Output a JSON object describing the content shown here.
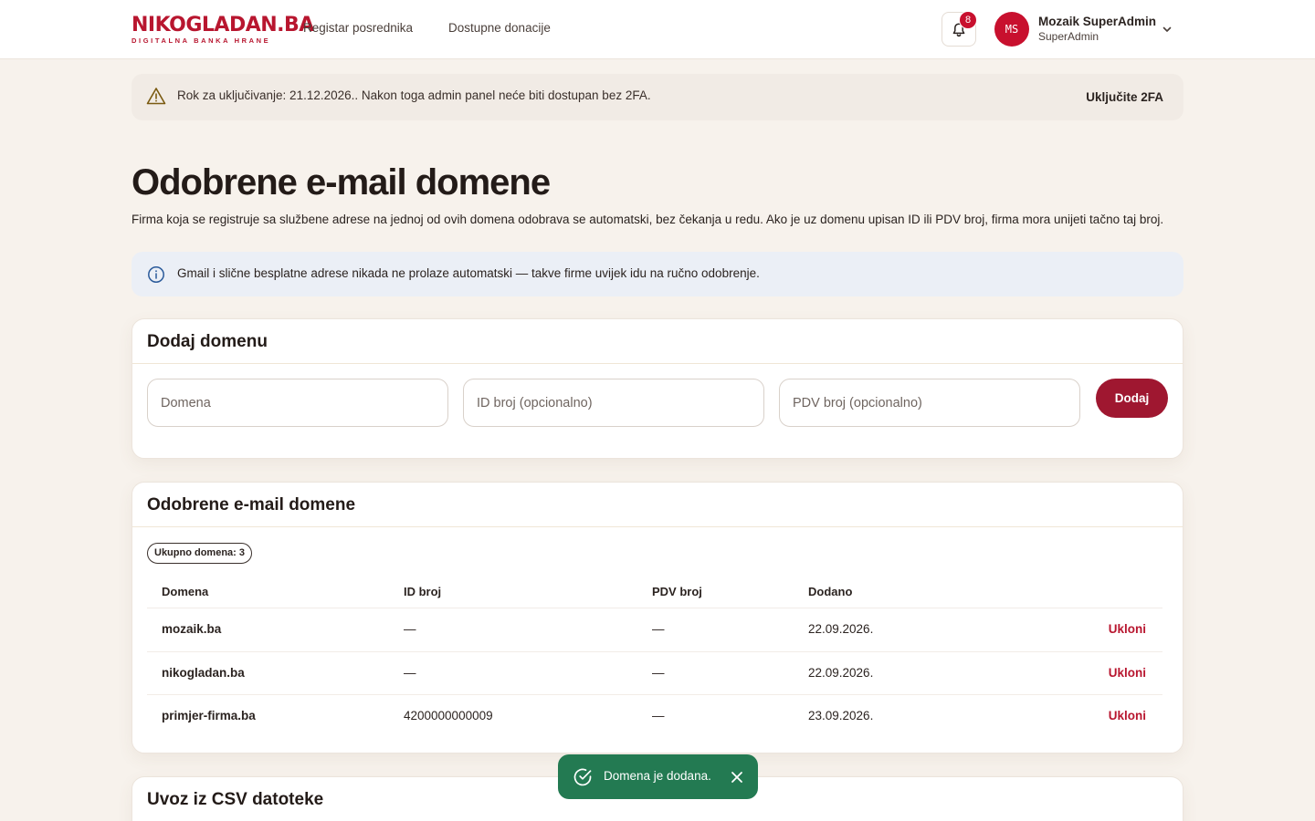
{
  "header": {
    "logo_part1": "NIKO",
    "logo_part2": "GLADAN.BA",
    "logo_sub": "DIGITALNA BANKA HRANE",
    "nav": [
      "Registar posrednika",
      "Dostupne donacije"
    ],
    "notifications_count": "8",
    "user_initials": "MS",
    "user_name": "Mozaik SuperAdmin",
    "user_role": "SuperAdmin"
  },
  "warning": {
    "text": "Rok za uključivanje: 21.12.2026.. Nakon toga admin panel neće biti dostupan bez 2FA.",
    "action": "Uključite 2FA"
  },
  "page": {
    "title": "Odobrene e-mail domene",
    "subtitle": "Firma koja se registruje sa službene adrese na jednoj od ovih domena odobrava se automatski, bez čekanja u redu. Ako je uz domenu upisan ID ili PDV broj, firma mora unijeti tačno taj broj."
  },
  "info": {
    "text": "Gmail i slične besplatne adrese nikada ne prolaze automatski — takve firme uvijek idu na ručno odobrenje."
  },
  "add_card": {
    "title": "Dodaj domenu",
    "domain_placeholder": "Domena",
    "id_placeholder": "ID broj (opcionalno)",
    "pdv_placeholder": "PDV broj (opcionalno)",
    "button": "Dodaj"
  },
  "list_card": {
    "title": "Odobrene e-mail domene",
    "count_label": "Ukupno domena: 3",
    "columns": [
      "Domena",
      "ID broj",
      "PDV broj",
      "Dodano"
    ],
    "rows": [
      {
        "domain": "mozaik.ba",
        "id": "—",
        "pdv": "—",
        "added": "22.09.2026.",
        "action": "Ukloni"
      },
      {
        "domain": "nikogladan.ba",
        "id": "—",
        "pdv": "—",
        "added": "22.09.2026.",
        "action": "Ukloni"
      },
      {
        "domain": "primjer-firma.ba",
        "id": "4200000000009",
        "pdv": "—",
        "added": "23.09.2026.",
        "action": "Ukloni"
      }
    ]
  },
  "csv_card": {
    "title": "Uvoz iz CSV datoteke"
  },
  "toast": {
    "text": "Domena je dodana."
  },
  "colors": {
    "brand": "#b8162f",
    "primary_button": "#9f1730",
    "toast_success": "#237a52",
    "info_bg": "#ebeff6",
    "warning_bg": "#f1ebe5"
  }
}
